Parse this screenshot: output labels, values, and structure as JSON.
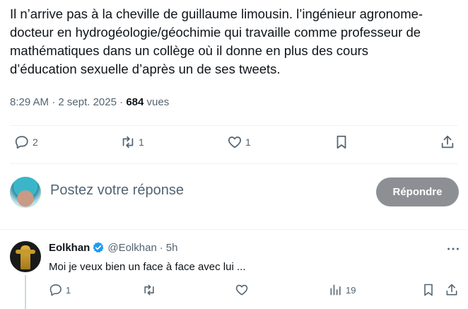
{
  "tweet": {
    "text": "Il n’arrive pas à la cheville de guillaume limousin. l’ingénieur agronome-\ndocteur en hydrogéologie/géochimie qui travaille comme professeur de\nmathématiques dans un collège où il donne en plus des cours\nd’éducation sexuelle d’après un de ses tweets.",
    "time": "8:29 AM",
    "date": "2 sept. 2025",
    "views_count": "684",
    "views_label": "vues",
    "separator": "·",
    "stats": {
      "replies": "2",
      "reposts": "1",
      "likes": "1"
    }
  },
  "composer": {
    "placeholder": "Postez votre réponse",
    "button_label": "Répondre",
    "button_color": "#8c9094"
  },
  "reply": {
    "author": "Eolkhan",
    "handle": "@Eolkhan",
    "separator": "·",
    "time": "5h",
    "text": "Moi je veux bien un face à face avec lui ...",
    "stats": {
      "replies": "1",
      "views": "19"
    }
  },
  "colors": {
    "text": "#0f1419",
    "muted": "#536471",
    "verified": "#1d9bf0",
    "divider": "#eff3f4"
  },
  "icons": [
    "reply-icon",
    "repost-icon",
    "like-icon",
    "bookmark-icon",
    "share-icon",
    "verified-icon",
    "more-icon",
    "views-icon"
  ]
}
